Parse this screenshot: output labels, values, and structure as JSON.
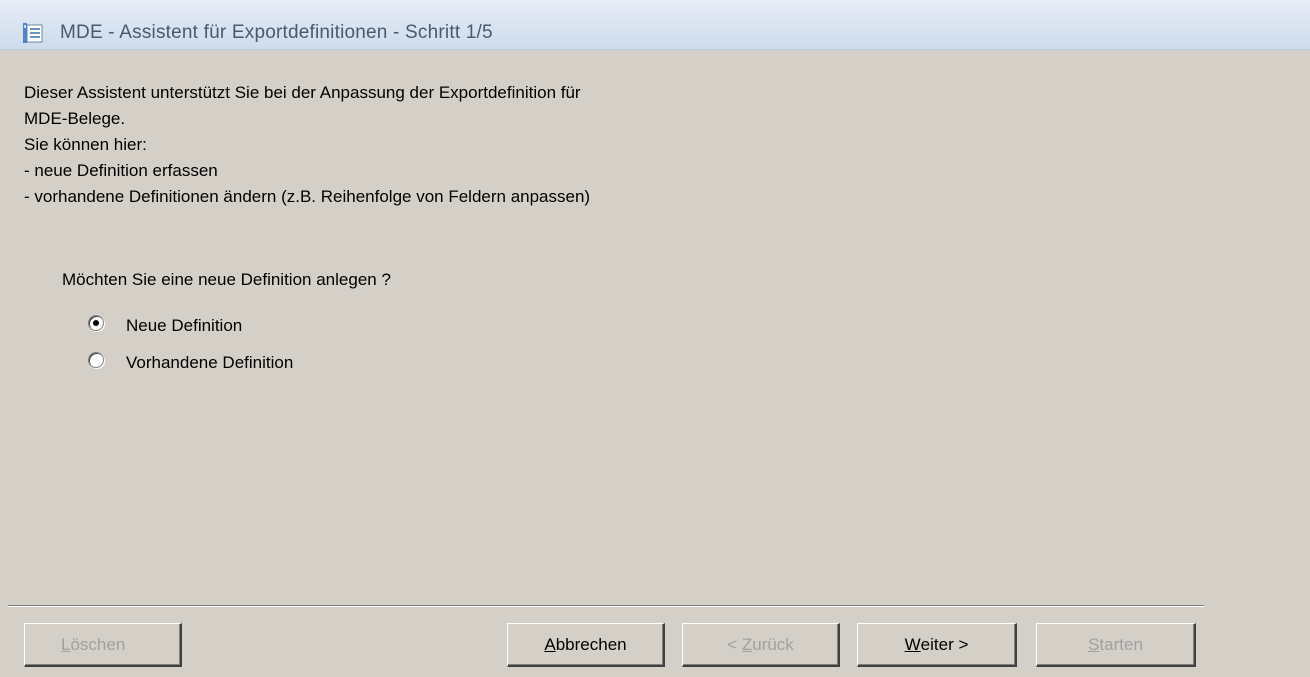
{
  "window": {
    "title": "MDE - Assistent für Exportdefinitionen - Schritt 1/5",
    "icon": "list-document-icon"
  },
  "intro": {
    "lines": [
      "Dieser Assistent unterstützt Sie bei der Anpassung der Exportdefinition für",
      "MDE-Belege.",
      "Sie können hier:",
      "- neue Definition erfassen",
      "- vorhandene Definitionen ändern (z.B. Reihenfolge von Feldern anpassen)"
    ]
  },
  "question": "Möchten Sie eine neue Definition anlegen ?",
  "options": [
    {
      "label": "Neue Definition",
      "checked": true
    },
    {
      "label": "Vorhandene Definition",
      "checked": false
    }
  ],
  "buttons": {
    "loeschen": {
      "accel": "L",
      "rest": "öschen",
      "enabled": false
    },
    "abbrechen": {
      "accel": "A",
      "rest": "bbrechen",
      "enabled": true
    },
    "zurueck": {
      "prefix": "< ",
      "accel": "Z",
      "rest": "urück",
      "enabled": false
    },
    "weiter": {
      "accel": "W",
      "rest": "eiter >",
      "enabled": true
    },
    "starten": {
      "accel": "S",
      "rest": "tarten",
      "enabled": false
    }
  },
  "colors": {
    "dialog_bg": "#d4d0c8",
    "titlebar": "#dbe5f2",
    "title_text": "#4a5a6e",
    "disabled_text": "#a0a0a0"
  }
}
